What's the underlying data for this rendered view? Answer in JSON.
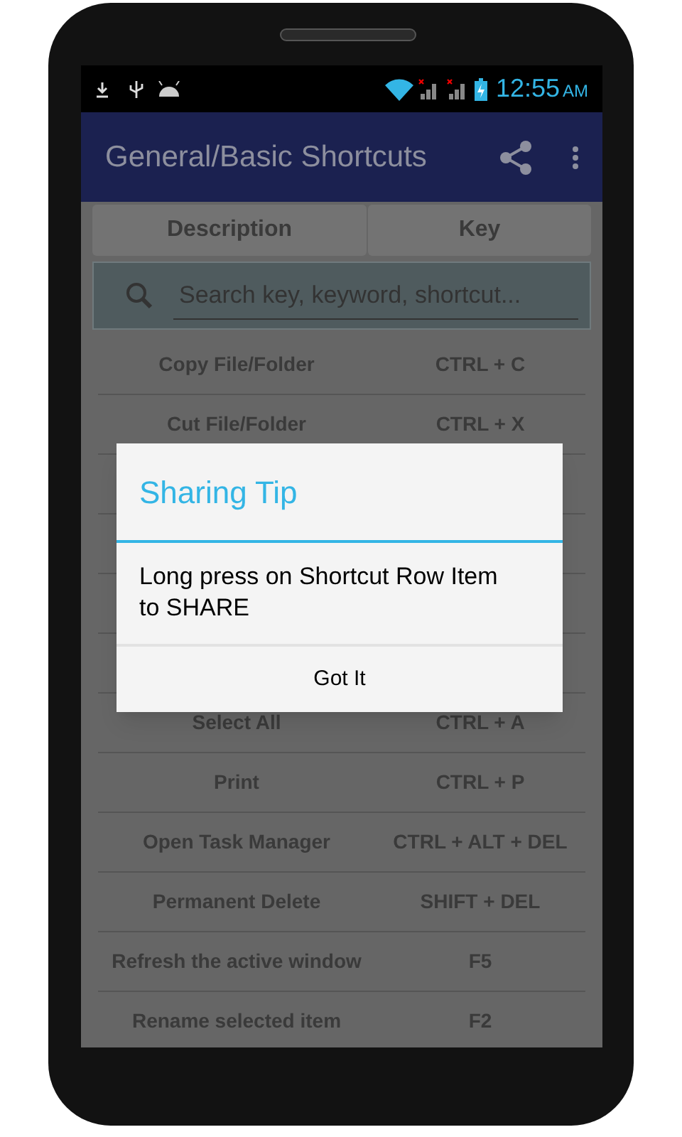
{
  "status_bar": {
    "time": "12:55",
    "meridiem": "AM"
  },
  "app_bar": {
    "title": "General/Basic Shortcuts"
  },
  "columns": [
    {
      "label": "Description"
    },
    {
      "label": "Key"
    }
  ],
  "search": {
    "placeholder": "Search key, keyword, shortcut..."
  },
  "rows": [
    {
      "description": "Copy File/Folder",
      "key": "CTRL + C"
    },
    {
      "description": "Cut File/Folder",
      "key": "CTRL + X"
    },
    {
      "description": "Select All",
      "key": "CTRL + A"
    },
    {
      "description": "Print",
      "key": "CTRL + P"
    },
    {
      "description": "Open Task Manager",
      "key": "CTRL + ALT + DEL"
    },
    {
      "description": "Permanent Delete",
      "key": "SHIFT + DEL"
    },
    {
      "description": "Refresh the active window",
      "key": "F5"
    },
    {
      "description": "Rename selected item",
      "key": "F2"
    }
  ],
  "dialog": {
    "title": "Sharing Tip",
    "message": "Long press on Shortcut Row Item to SHARE",
    "button": "Got It"
  }
}
